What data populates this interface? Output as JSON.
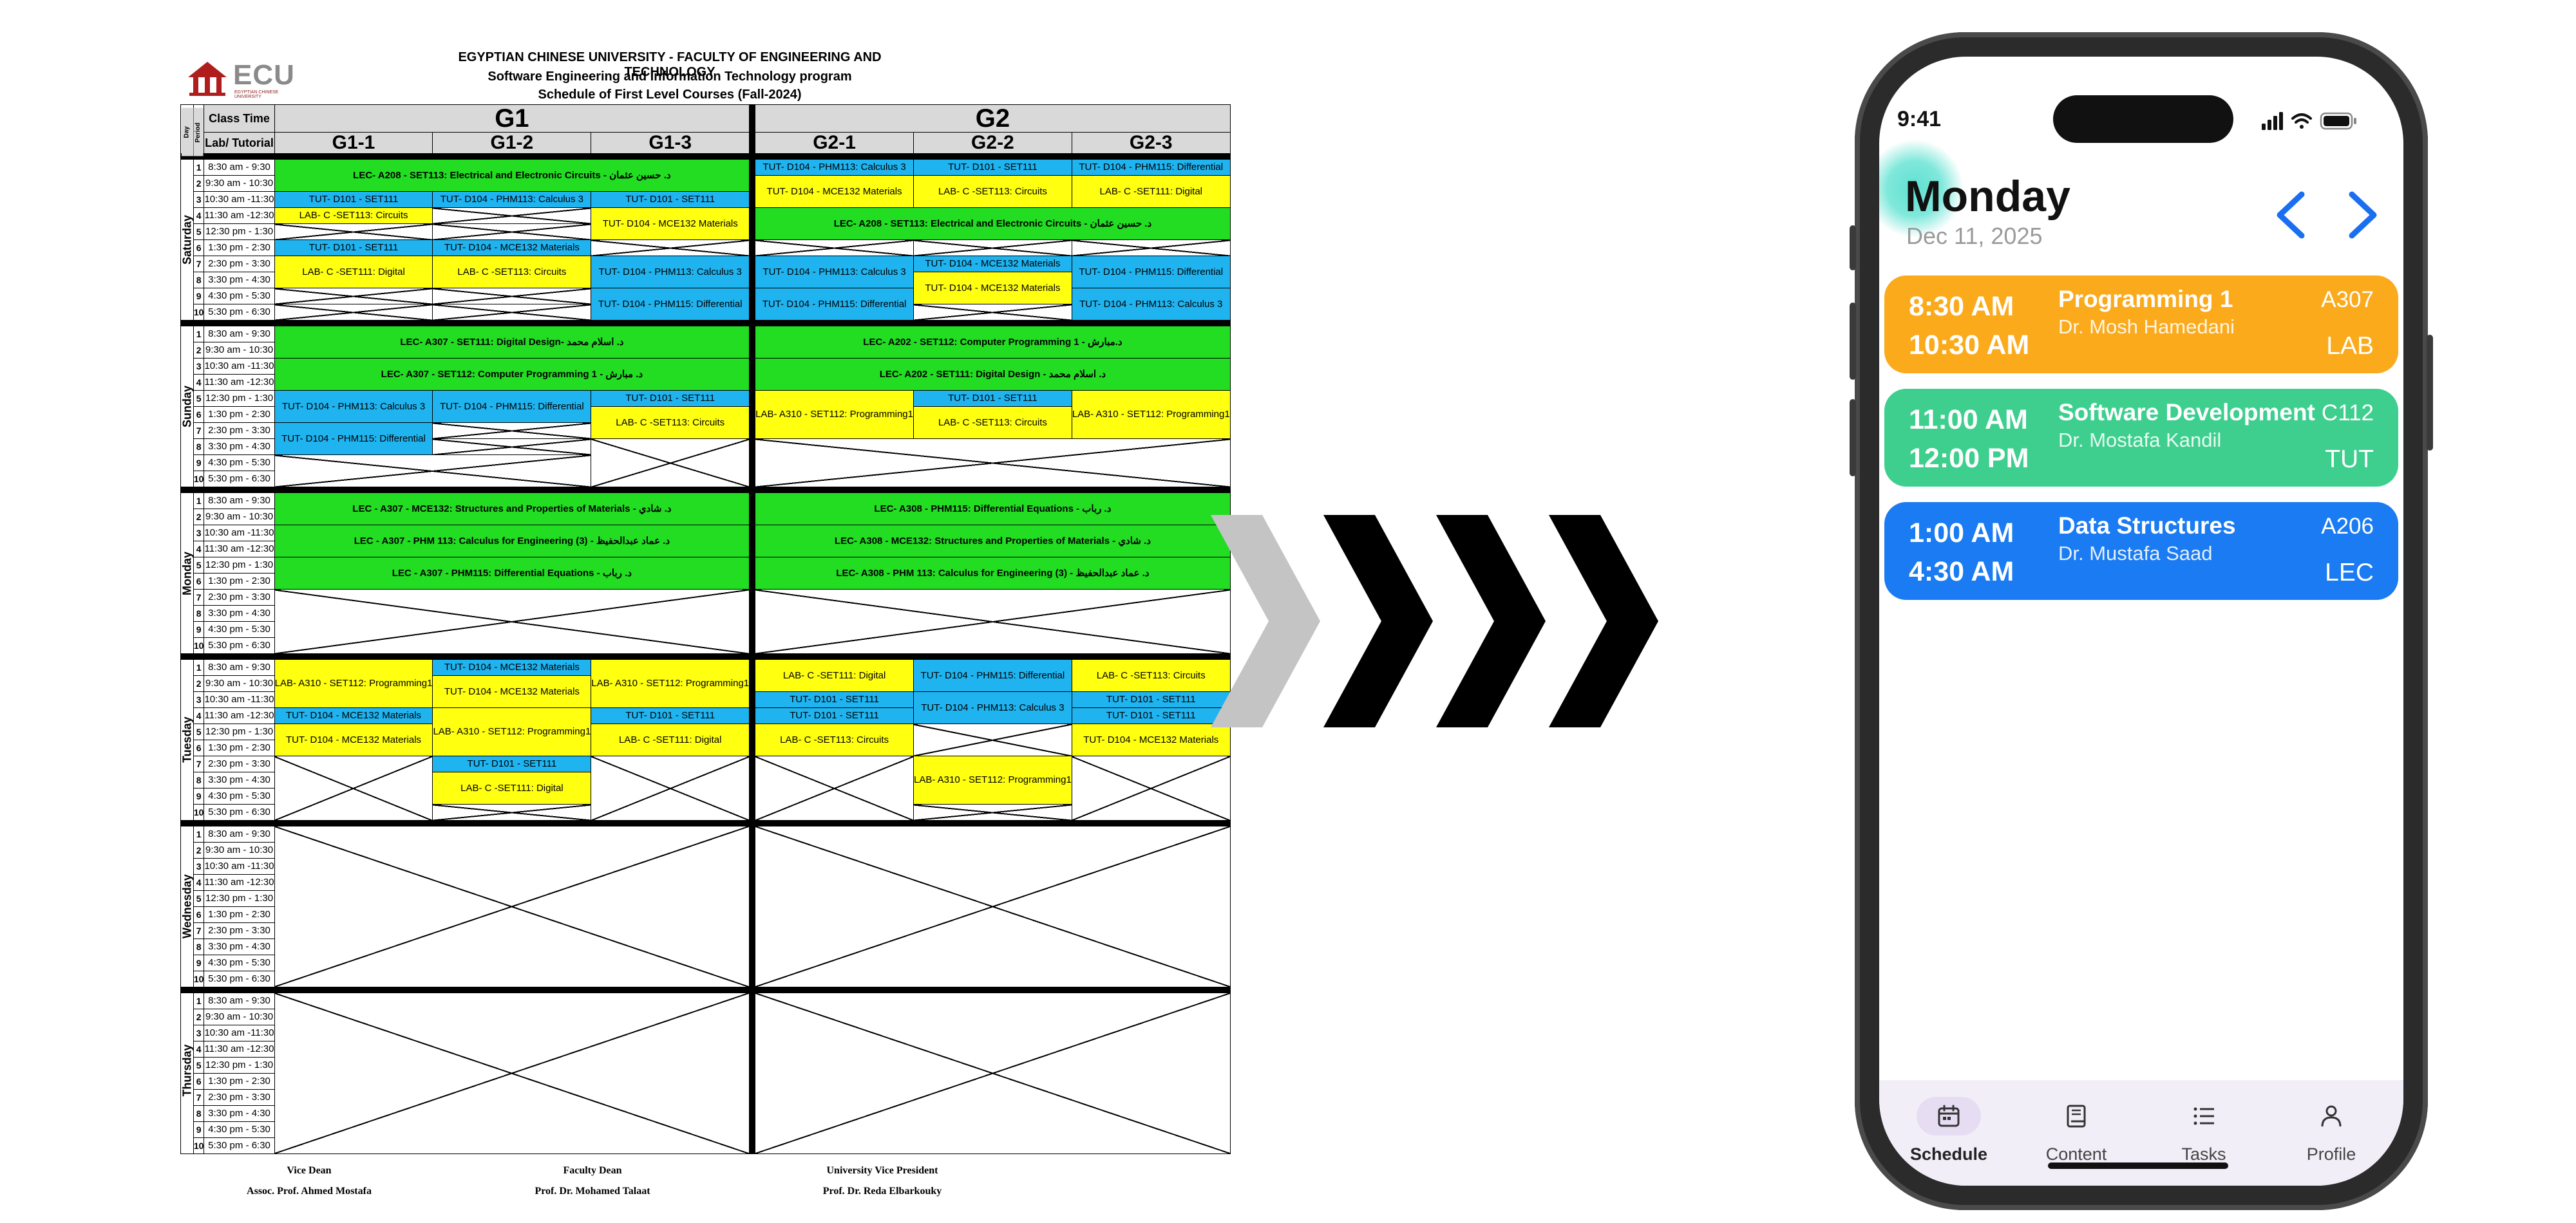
{
  "document": {
    "logo_text": "ECU",
    "logo_subtitle": "EGYPTIAN CHINESE UNIVERSITY",
    "title": "EGYPTIAN CHINESE UNIVERSITY - FACULTY OF ENGINEERING AND TECHNOLOGY",
    "program": "Software Engineering and Information Technology program",
    "schedule": "Schedule of First Level Courses (Fall-2024)",
    "headers": {
      "day": "Day",
      "period": "Period",
      "class_time": "Class Time",
      "lab_tutorial": "Lab/ Tutorial",
      "g1": "G1",
      "g2": "G2",
      "groups": [
        "G1-1",
        "G1-2",
        "G1-3",
        "G2-1",
        "G2-2",
        "G2-3"
      ]
    },
    "days": [
      "Saturday",
      "Sunday",
      "Monday",
      "Tuesday",
      "Wednesday",
      "Thursday"
    ],
    "times": [
      "8:30 am - 9:30",
      "9:30 am - 10:30",
      "10:30 am -11:30",
      "11:30 am -12:30",
      "12:30 pm - 1:30",
      "1:30 pm - 2:30",
      "2:30 pm - 3:30",
      "3:30 pm - 4:30",
      "4:30 pm - 5:30",
      "5:30 pm - 6:30"
    ],
    "lectures": {
      "sat_g1": "LEC- A208 - SET113: Electrical and Electronic Circuits - د. حسين عثمان",
      "sat_g2": "LEC- A208 - SET113: Electrical and Electronic Circuits - د. حسين عثمان",
      "sun_g1_a": "LEC- A307 - SET111: Digital Design- د. اسلام محمد",
      "sun_g1_b": "LEC- A307 - SET112: Computer Programming 1 - د. مبارش",
      "sun_g2_a": "LEC- A202 - SET112: Computer Programming 1 - د.مبارش",
      "sun_g2_b": "LEC- A202 - SET111: Digital Design - د. اسلام محمد",
      "mon_g1_a": "LEC - A307 - MCE132: Structures and Properties of Materials - د. شادي",
      "mon_g1_b": "LEC - A307 - PHM 113: Calculus for Engineering (3) - د. عماد عبدالحفيظ",
      "mon_g1_c": "LEC - A307 - PHM115: Differential Equations - د. رباب",
      "mon_g2_a": "LEC- A308 - PHM115: Differential Equations - د. رباب",
      "mon_g2_b": "LEC- A308 - MCE132: Structures and Properties of Materials - د. شادي",
      "mon_g2_c": "LEC- A308 - PHM 113: Calculus for Engineering (3) - د. عماد عبدالحفيظ"
    },
    "small": {
      "tut_calc": "TUT- D104 - PHM113: Calculus 3",
      "tut_diff": "TUT- D104 - PHM115: Differential",
      "tut_mce": "TUT- D104 - MCE132 Materials",
      "lab_circ": "LAB- C -SET113: Circuits",
      "lab_dig": "LAB- C -SET111: Digital",
      "lab_prog": "LAB- A310 - SET112: Programming1",
      "tut_set": "TUT- D101 - SET111"
    },
    "footer": {
      "vice_dean_title": "Vice Dean",
      "vice_dean_name": "Assoc. Prof. Ahmed Mostafa",
      "dean_title": "Faculty Dean",
      "dean_name": "Prof. Dr. Mohamed Talaat",
      "vp_title": "University Vice President",
      "vp_name": "Prof. Dr. Reda Elbarkouky"
    }
  },
  "phone": {
    "status_time": "9:41",
    "day_title": "Monday",
    "date": "Dec 11, 2025",
    "classes": [
      {
        "start": "8:30 AM",
        "end": "10:30 AM",
        "name": "Programming 1",
        "instructor": "Dr. Mosh Hamedani",
        "room": "A307",
        "kind": "LAB",
        "color": "#FBAA1C"
      },
      {
        "start": "11:00 AM",
        "end": "12:00 PM",
        "name": "Software Development",
        "instructor": "Dr. Mostafa Kandil",
        "room": "C112",
        "kind": "TUT",
        "color": "#3ECF8E"
      },
      {
        "start": "1:00 AM",
        "end": "4:30 AM",
        "name": "Data Structures",
        "instructor": "Dr. Mustafa Saad",
        "room": "A206",
        "kind": "LEC",
        "color": "#1A7BF2"
      }
    ],
    "nav": [
      {
        "label": "Schedule",
        "icon": "calendar-icon",
        "active": true
      },
      {
        "label": "Content",
        "icon": "book-icon",
        "active": false
      },
      {
        "label": "Tasks",
        "icon": "list-icon",
        "active": false
      },
      {
        "label": "Profile",
        "icon": "person-icon",
        "active": false
      }
    ],
    "accent_teal": "#6FE3D5",
    "nav_active_bg": "#E6DDF3"
  }
}
